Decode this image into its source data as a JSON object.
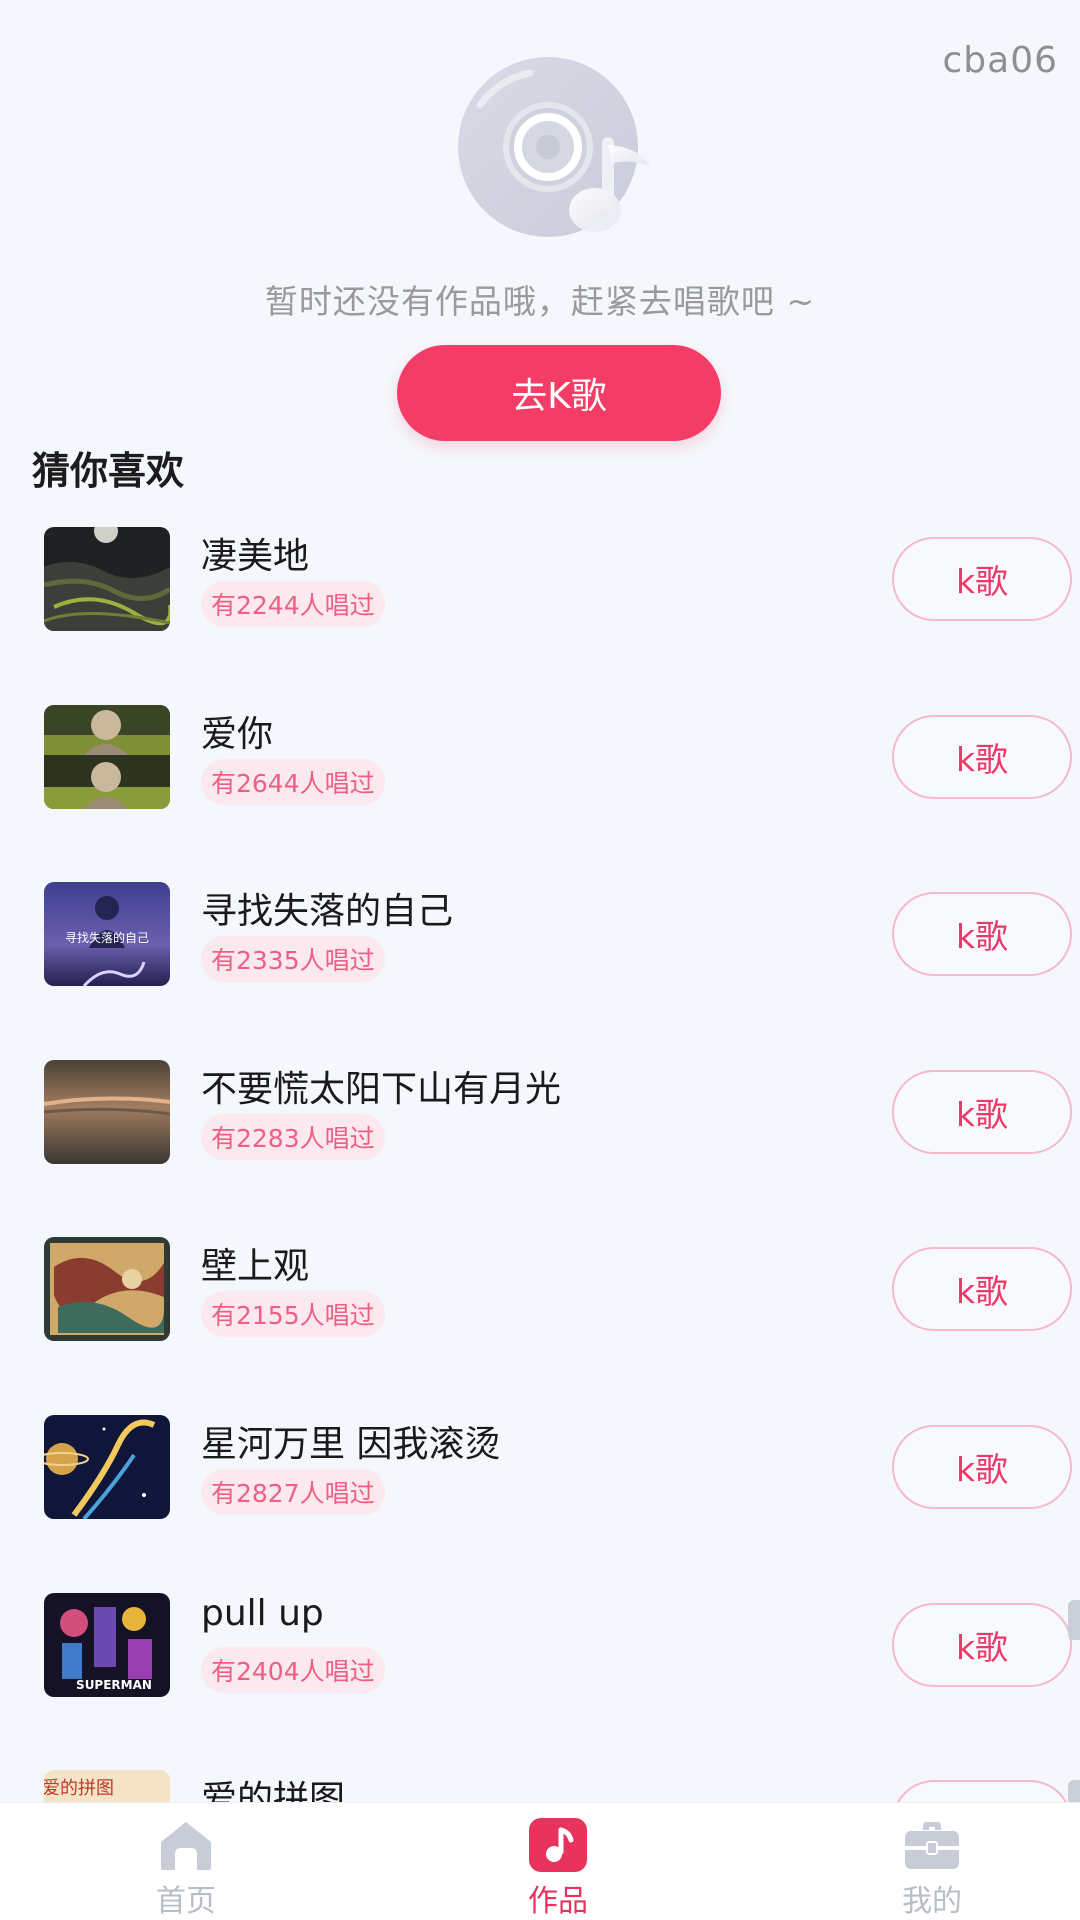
{
  "header": {
    "user_tag": "cba06"
  },
  "empty_state": {
    "icon": "vinyl-record-icon",
    "message": "暂时还没有作品哦，赶紧去唱歌吧 ~",
    "cta_label": "去K歌"
  },
  "recommend": {
    "title": "猜你喜欢",
    "button_label": "k歌",
    "songs": [
      {
        "title": "凄美地",
        "sung": "有2244人唱过"
      },
      {
        "title": "爱你",
        "sung": "有2644人唱过"
      },
      {
        "title": "寻找失落的自己",
        "sung": "有2335人唱过",
        "cover_text": "寻找失落的自己"
      },
      {
        "title": "不要慌太阳下山有月光",
        "sung": "有2283人唱过"
      },
      {
        "title": "壁上观",
        "sung": "有2155人唱过"
      },
      {
        "title": "星河万里 因我滚烫",
        "sung": "有2827人唱过"
      },
      {
        "title": "pull up",
        "sung": "有2404人唱过",
        "cover_text": "SUPERMAN"
      },
      {
        "title": "爱的拼图",
        "sung": "",
        "cover_text": "爱的拼图"
      }
    ]
  },
  "tabbar": {
    "tabs": [
      {
        "label": "首页",
        "icon": "home-icon"
      },
      {
        "label": "作品",
        "icon": "music-note-icon",
        "active": true
      },
      {
        "label": "我的",
        "icon": "toolbox-icon"
      }
    ]
  },
  "colors": {
    "accent": "#f33d66",
    "badge_bg": "#fbe9ef",
    "badge_text": "#ef5f83"
  }
}
